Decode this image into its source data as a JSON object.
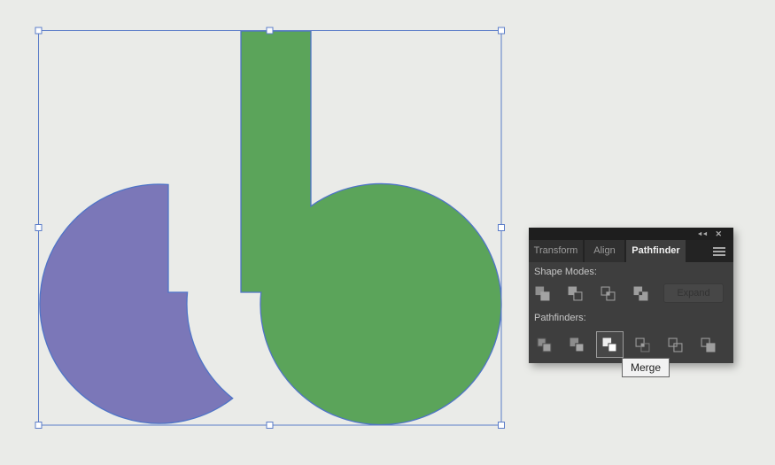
{
  "panel": {
    "title_bar": {
      "collapse_icon": "double-left-arrows",
      "close_icon": "x",
      "collapse_glyph": "◄◄",
      "close_glyph": "✕"
    },
    "tabs": [
      {
        "label": "Transform",
        "active": false
      },
      {
        "label": "Align",
        "active": false
      },
      {
        "label": "Pathfinder",
        "active": true
      }
    ],
    "shape_modes": {
      "heading": "Shape Modes:",
      "buttons": [
        "Unite",
        "Minus Front",
        "Intersect",
        "Exclude"
      ],
      "expand_button": {
        "label": "Expand",
        "enabled": false
      }
    },
    "pathfinders": {
      "heading": "Pathfinders:",
      "buttons": [
        "Divide",
        "Trim",
        "Merge",
        "Crop",
        "Outline",
        "Minus Back"
      ],
      "hovered_button": "Merge"
    }
  },
  "tooltip": {
    "text": "Merge"
  },
  "canvas": {
    "background_color": "#eaebe8",
    "shapes": [
      {
        "name": "purple-notched-circle",
        "fill": "#7b77b8",
        "stroke": "#4f74c7"
      },
      {
        "name": "green-b-shape",
        "fill": "#5ba45a",
        "stroke": "#4f74c7"
      }
    ],
    "selection": {
      "border_color": "#5b7cc8",
      "handle_fill": "#ffffff",
      "handle_count": 8
    }
  }
}
